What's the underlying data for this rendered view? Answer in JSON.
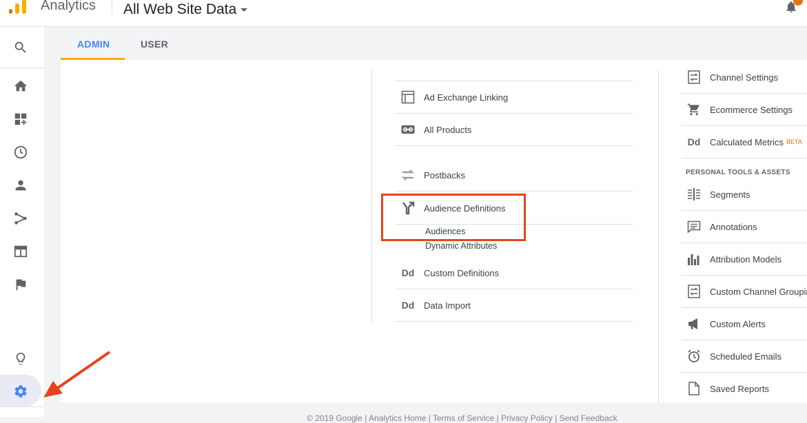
{
  "header": {
    "app_name": "Analytics",
    "property": "All Web Site Data"
  },
  "tabs": [
    {
      "label": "ADMIN"
    },
    {
      "label": "USER"
    }
  ],
  "middle_column": {
    "items": [
      {
        "label": "Ad Exchange Linking",
        "icon": "ad-exchange-icon"
      },
      {
        "label": "All Products",
        "icon": "link-icon"
      },
      {
        "label": "Postbacks",
        "icon": "postbacks-icon"
      },
      {
        "label": "Audience Definitions",
        "icon": "audience-fork-icon"
      },
      {
        "label": "Custom Definitions",
        "icon": "dd-icon",
        "icon_text": "Dd"
      },
      {
        "label": "Data Import",
        "icon": "dd-icon",
        "icon_text": "Dd"
      }
    ],
    "audience_subitems": [
      {
        "label": "Audiences"
      },
      {
        "label": "Dynamic Attributes"
      }
    ]
  },
  "right_column": {
    "items_top": [
      {
        "label": "Channel Settings",
        "icon": "channel-settings-icon"
      },
      {
        "label": "Ecommerce Settings",
        "icon": "cart-icon"
      },
      {
        "label": "Calculated Metrics",
        "icon": "dd-icon",
        "icon_text": "Dd",
        "badge": "BETA"
      }
    ],
    "section_title": "PERSONAL TOOLS & ASSETS",
    "items_personal": [
      {
        "label": "Segments",
        "icon": "segments-icon"
      },
      {
        "label": "Annotations",
        "icon": "annotations-icon"
      },
      {
        "label": "Attribution Models",
        "icon": "attribution-icon"
      },
      {
        "label": "Custom Channel Grouping",
        "icon": "custom-channel-icon"
      },
      {
        "label": "Custom Alerts",
        "icon": "megaphone-icon"
      },
      {
        "label": "Scheduled Emails",
        "icon": "alarm-icon"
      },
      {
        "label": "Saved Reports",
        "icon": "document-icon"
      }
    ]
  },
  "footer": {
    "text": "© 2019 Google | Analytics Home | Terms of Service | Privacy Policy | Send Feedback"
  },
  "colors": {
    "accent": "#4285f4",
    "tab_underline": "#f9ab00",
    "annotation_red": "#e8431a",
    "logo_orange": "#e37400"
  }
}
